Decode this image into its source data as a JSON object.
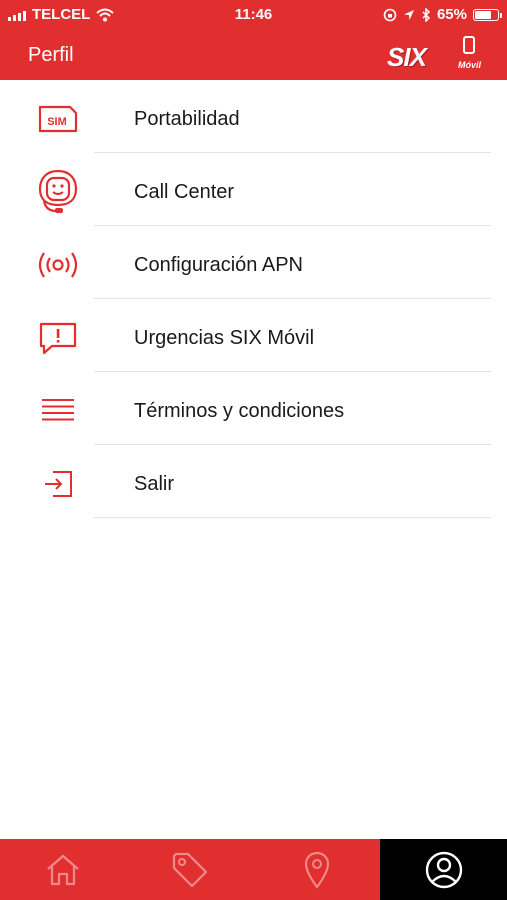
{
  "status_bar": {
    "carrier": "TELCEL",
    "time": "11:46",
    "battery": "65%",
    "battery_level": 0.65
  },
  "header": {
    "title": "Perfil",
    "brand_main": "SIX",
    "brand_sub": "Móvil"
  },
  "menu": {
    "items": [
      {
        "label": "Portabilidad",
        "icon": "sim-card-icon"
      },
      {
        "label": "Call Center",
        "icon": "support-agent-icon"
      },
      {
        "label": "Configuración APN",
        "icon": "broadcast-signal-icon"
      },
      {
        "label": "Urgencias SIX Móvil",
        "icon": "alert-message-icon"
      },
      {
        "label": "Términos y condiciones",
        "icon": "text-lines-icon"
      },
      {
        "label": "Salir",
        "icon": "logout-icon"
      }
    ]
  },
  "tabbar": {
    "tabs": [
      {
        "icon": "home-icon",
        "active": false
      },
      {
        "icon": "tag-icon",
        "active": false
      },
      {
        "icon": "location-pin-icon",
        "active": false
      },
      {
        "icon": "profile-icon",
        "active": true
      }
    ]
  },
  "colors": {
    "accent": "#e12f2f",
    "active_tab": "#000000",
    "inactive_tab_icon": "#f08a8a"
  }
}
